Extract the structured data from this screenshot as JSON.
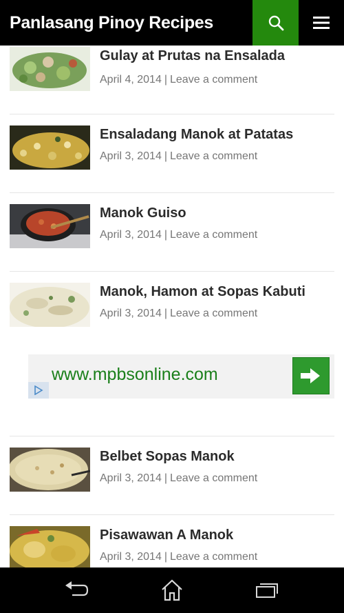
{
  "header": {
    "site_title": "Panlasang Pinoy Recipes",
    "accent_color": "#24890d",
    "search_icon": "search-icon",
    "menu_icon": "hamburger-menu-icon"
  },
  "posts": [
    {
      "title": "Gulay at Prutas na Ensalada",
      "date": "April 4, 2014",
      "separator": "|",
      "comment_link": "Leave a comment"
    },
    {
      "title": "Ensaladang Manok at Patatas",
      "date": "April 3, 2014",
      "separator": "|",
      "comment_link": "Leave a comment"
    },
    {
      "title": "Manok Guiso",
      "date": "April 3, 2014",
      "separator": "|",
      "comment_link": "Leave a comment"
    },
    {
      "title": "Manok, Hamon at Sopas Kabuti",
      "date": "April 3, 2014",
      "separator": "|",
      "comment_link": "Leave a comment"
    },
    {
      "title": "Belbet Sopas Manok",
      "date": "April 3, 2014",
      "separator": "|",
      "comment_link": "Leave a comment"
    },
    {
      "title": "Pisawawan A Manok",
      "date": "April 3, 2014",
      "separator": "|",
      "comment_link": "Leave a comment"
    }
  ],
  "ad": {
    "url_text": "www.mpbsonline.com",
    "arrow_icon": "arrow-right-icon",
    "adchoices_icon": "adchoices-icon"
  },
  "navbar": {
    "back_icon": "back-icon",
    "home_icon": "home-icon",
    "recents_icon": "recent-apps-icon"
  }
}
